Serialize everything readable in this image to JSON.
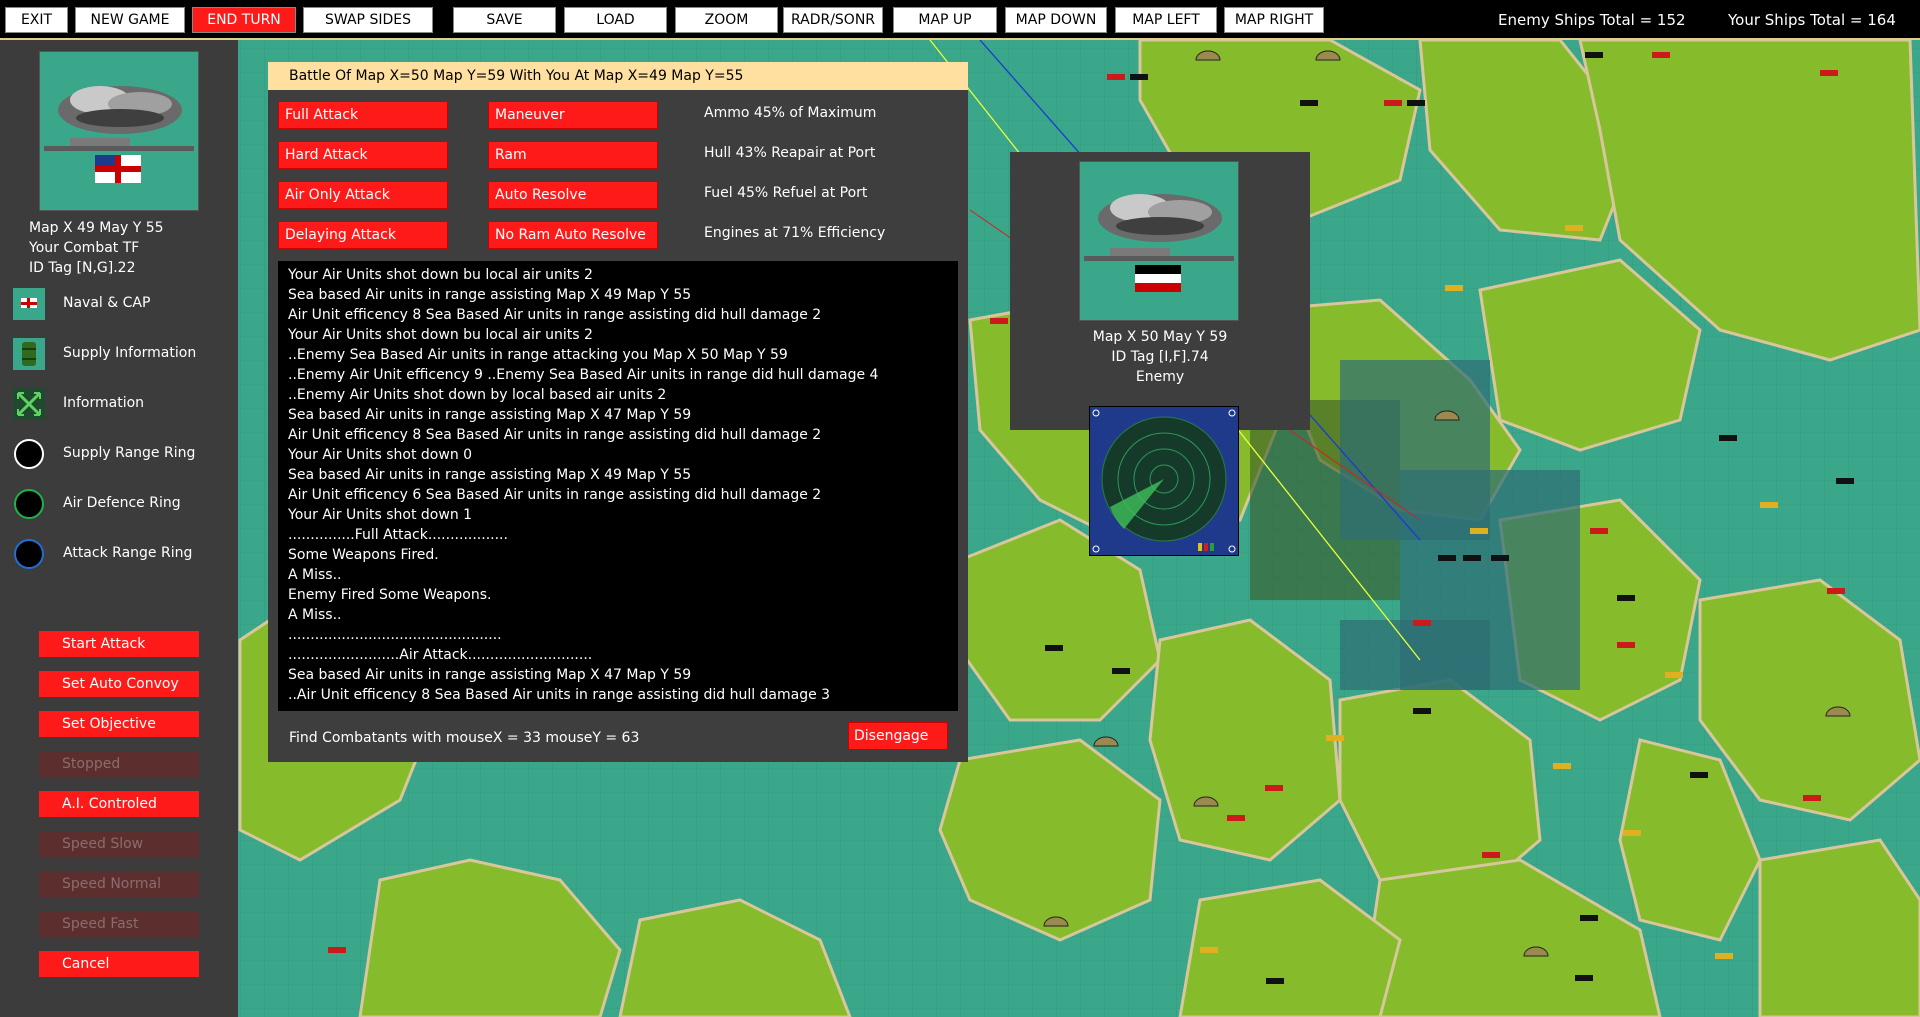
{
  "toolbar": {
    "exit": "EXIT",
    "new_game": "NEW GAME",
    "end_turn": "END TURN",
    "swap_sides": "SWAP SIDES",
    "save": "SAVE",
    "load": "LOAD",
    "zoom": "ZOOM",
    "radr_sonr": "RADR/SONR",
    "map_up": "MAP UP",
    "map_down": "MAP DOWN",
    "map_left": "MAP LEFT",
    "map_right": "MAP RIGHT",
    "enemy_total": "Enemy Ships Total = 152",
    "your_total": "Your Ships Total = 164"
  },
  "left": {
    "map_pos": "Map X 49  May Y 55",
    "combat": "Your Combat TF",
    "id_tag": "ID Tag [N,G].22",
    "menu": [
      {
        "label": "Naval & CAP"
      },
      {
        "label": "Supply Information"
      },
      {
        "label": "Information"
      },
      {
        "label": "Supply Range Ring"
      },
      {
        "label": "Air Defence Ring"
      },
      {
        "label": "Attack Range Ring"
      }
    ],
    "buttons": [
      {
        "label": "Start Attack",
        "enabled": true
      },
      {
        "label": "Set Auto Convoy",
        "enabled": true
      },
      {
        "label": "Set Objective",
        "enabled": true
      },
      {
        "label": "Stopped",
        "enabled": false
      },
      {
        "label": "A.I. Controled",
        "enabled": true
      },
      {
        "label": "Speed Slow",
        "enabled": false
      },
      {
        "label": "Speed Normal",
        "enabled": false
      },
      {
        "label": "Speed Fast",
        "enabled": false
      },
      {
        "label": "Cancel",
        "enabled": true
      }
    ]
  },
  "battle": {
    "title": "Battle Of Map X=50  Map Y=59  With You At Map X=49  Map Y=55",
    "buttons": [
      "Full Attack",
      "Maneuver",
      "Hard Attack",
      "Ram",
      "Air Only Attack",
      "Auto Resolve",
      "Delaying Attack",
      "No Ram Auto Resolve"
    ],
    "stats": [
      "Ammo 45% of Maximum",
      "Hull 43% Reapair at Port",
      "Fuel 45% Refuel at Port",
      "Engines at 71% Efficiency"
    ],
    "log": [
      "Your Air Units shot down bu local air units 2",
      "Sea based Air units in range assisting Map X 49  Map Y 55",
      "Air Unit efficency 8  Sea Based Air units in range assisting did hull damage 2",
      "Your Air Units shot down bu local air units 2",
      "..Enemy Sea Based Air units in range attacking you Map X 50  Map Y 59",
      "..Enemy Air Unit efficency 9 ..Enemy  Sea Based Air units in range did hull damage 4",
      "..Enemy Air Units shot down by local based air units 2",
      "Sea based Air units in range assisting Map X 47  Map Y 59",
      "Air Unit efficency 8  Sea Based Air units in range assisting did hull damage 2",
      "Your Air Units shot down 0",
      "Sea based Air units in range assisting Map X 49  Map Y 55",
      "Air Unit efficency 6  Sea Based Air units in range assisting did hull damage 2",
      "Your Air Units shot down 1",
      "...............Full Attack..................",
      "Some Weapons Fired.",
      "A Miss..",
      "Enemy Fired Some Weapons.",
      "A Miss..",
      "................................................",
      ".........................Air Attack............................",
      "Sea based Air units in range assisting Map X 47  Map Y 59",
      "..Air Unit efficency 8  Sea Based Air units in range assisting did hull damage 3"
    ],
    "find": "Find Combatants with mouseX = 33 mouseY = 63",
    "disengage": "Disengage"
  },
  "enemy": {
    "map_pos": "Map X 50  May Y 59",
    "id_tag": "ID Tag [I,F].74",
    "side": "Enemy"
  },
  "colors": {
    "button_red": "#ff1a1a",
    "sea": "#3aa68a",
    "land": "#86bb2c",
    "panel": "#3c3c3c"
  }
}
